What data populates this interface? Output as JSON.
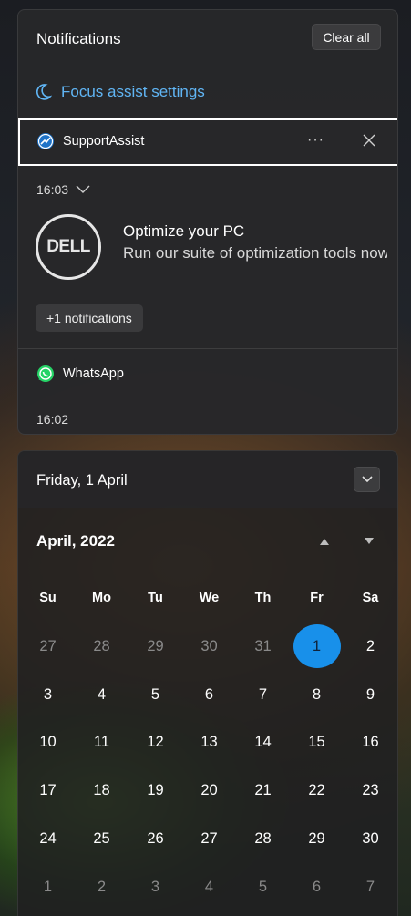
{
  "notifications": {
    "title": "Notifications",
    "clear_all_label": "Clear all",
    "focus_assist_label": "Focus assist settings",
    "apps": [
      {
        "name": "SupportAssist",
        "icon": "supportassist-icon",
        "time": "16:03",
        "toast": {
          "title": "Optimize your PC",
          "body": "Run our suite of optimization tools now",
          "logo_text": "DELL"
        },
        "more_label": "+1 notifications"
      },
      {
        "name": "WhatsApp",
        "icon": "whatsapp-icon",
        "time": "16:02"
      }
    ]
  },
  "calendar": {
    "date_label": "Friday, 1 April",
    "month_label": "April, 2022",
    "weekday_headers": [
      "Su",
      "Mo",
      "Tu",
      "We",
      "Th",
      "Fr",
      "Sa"
    ],
    "days": [
      {
        "d": "27",
        "dim": true
      },
      {
        "d": "28",
        "dim": true
      },
      {
        "d": "29",
        "dim": true
      },
      {
        "d": "30",
        "dim": true
      },
      {
        "d": "31",
        "dim": true
      },
      {
        "d": "1",
        "today": true
      },
      {
        "d": "2"
      },
      {
        "d": "3"
      },
      {
        "d": "4"
      },
      {
        "d": "5"
      },
      {
        "d": "6"
      },
      {
        "d": "7"
      },
      {
        "d": "8"
      },
      {
        "d": "9"
      },
      {
        "d": "10"
      },
      {
        "d": "11"
      },
      {
        "d": "12"
      },
      {
        "d": "13"
      },
      {
        "d": "14"
      },
      {
        "d": "15"
      },
      {
        "d": "16"
      },
      {
        "d": "17"
      },
      {
        "d": "18"
      },
      {
        "d": "19"
      },
      {
        "d": "20"
      },
      {
        "d": "21"
      },
      {
        "d": "22"
      },
      {
        "d": "23"
      },
      {
        "d": "24"
      },
      {
        "d": "25"
      },
      {
        "d": "26"
      },
      {
        "d": "27"
      },
      {
        "d": "28"
      },
      {
        "d": "29"
      },
      {
        "d": "30"
      },
      {
        "d": "1",
        "dim": true
      },
      {
        "d": "2",
        "dim": true
      },
      {
        "d": "3",
        "dim": true
      },
      {
        "d": "4",
        "dim": true
      },
      {
        "d": "5",
        "dim": true
      },
      {
        "d": "6",
        "dim": true
      },
      {
        "d": "7",
        "dim": true
      }
    ]
  },
  "colors": {
    "accent": "#1890ea",
    "link": "#60b5f4",
    "whatsapp": "#25d366"
  }
}
